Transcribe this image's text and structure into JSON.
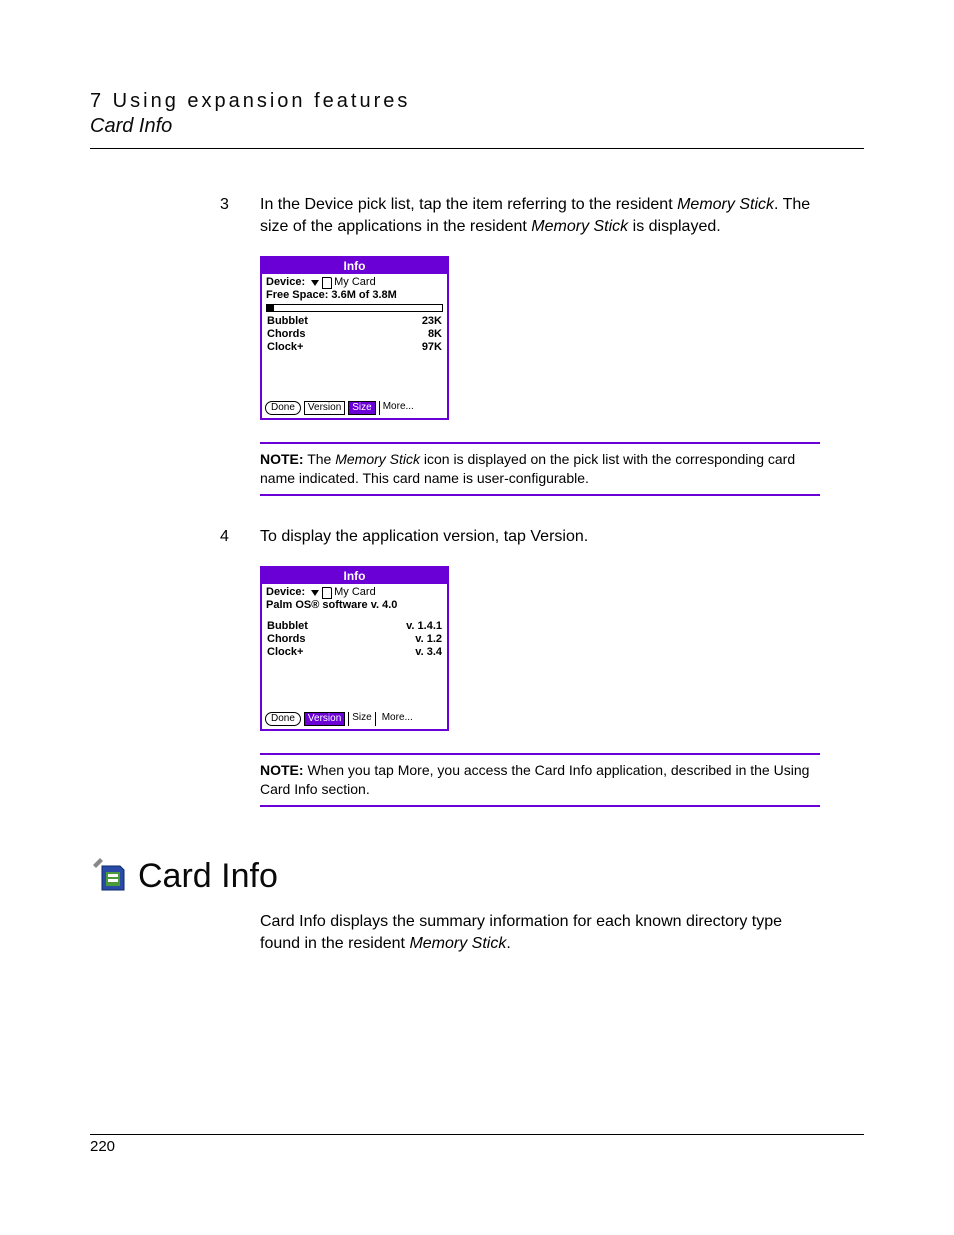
{
  "header": {
    "chapter": "7 Using expansion features",
    "section": "Card Info"
  },
  "step3": {
    "num": "3",
    "text_a": "In the Device pick list, tap the item referring to the resident ",
    "text_em": "Memory Stick",
    "text_b": ". The size of the applications in the resident ",
    "text_em2": "Memory Stick",
    "text_c": " is displayed."
  },
  "palm1": {
    "title": "Info",
    "device_label": "Device:",
    "device_value": "My Card",
    "free_space": "Free Space: 3.6M of 3.8M",
    "rows": [
      {
        "name": "Bubblet",
        "size": "23K"
      },
      {
        "name": "Chords",
        "size": "8K"
      },
      {
        "name": "Clock+",
        "size": "97K"
      }
    ],
    "btn_done": "Done",
    "btn_version": "Version",
    "btn_size": "Size",
    "btn_more": "More..."
  },
  "note1": {
    "label": "NOTE:",
    "a": " The ",
    "em": "Memory Stick",
    "b": " icon is displayed on the pick list with the corresponding card name indicated. This card name is user-configurable."
  },
  "step4": {
    "num": "4",
    "text": "To display the application version, tap Version."
  },
  "palm2": {
    "title": "Info",
    "device_label": "Device:",
    "device_value": "My Card",
    "os_line": "Palm OS® software v. 4.0",
    "rows": [
      {
        "name": "Bubblet",
        "ver": "v. 1.4.1"
      },
      {
        "name": "Chords",
        "ver": "v. 1.2"
      },
      {
        "name": "Clock+",
        "ver": "v. 3.4"
      }
    ],
    "btn_done": "Done",
    "btn_version": "Version",
    "btn_size": "Size",
    "btn_more": "More..."
  },
  "note2": {
    "label": "NOTE:",
    "text": " When you tap More, you access the Card Info application, described in the Using Card Info section."
  },
  "section": {
    "title": "Card Info",
    "para_a": "Card Info displays the summary information for each known directory type found in the resident ",
    "para_em": "Memory Stick",
    "para_b": "."
  },
  "page_number": "220"
}
